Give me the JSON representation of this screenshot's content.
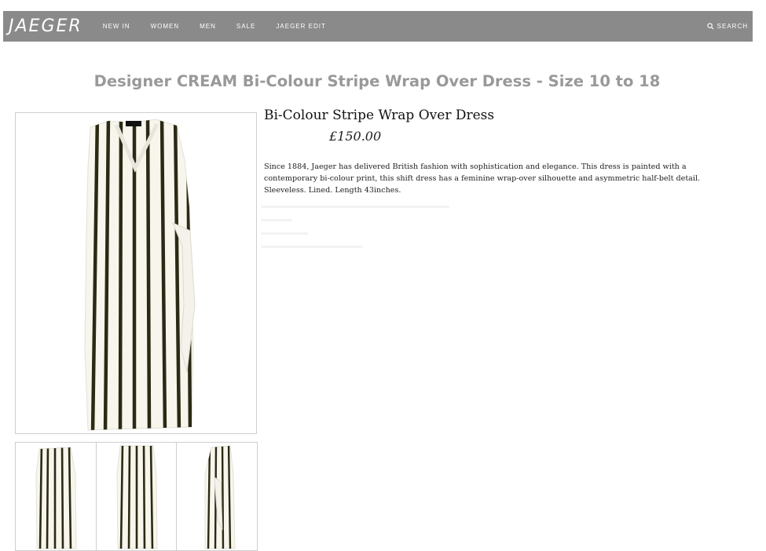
{
  "nav": {
    "logo": "JAEGER",
    "items": [
      {
        "label": "NEW IN"
      },
      {
        "label": "WOMEN"
      },
      {
        "label": "MEN"
      },
      {
        "label": "SALE"
      },
      {
        "label": "JAEGER EDIT"
      }
    ],
    "search_label": "SEARCH",
    "background": "#8a8a8a"
  },
  "page": {
    "title": "Designer CREAM Bi-Colour Stripe Wrap Over Dress - Size 10 to 18"
  },
  "product": {
    "name": "Bi-Colour Stripe Wrap Over Dress",
    "price": "£150.00",
    "description": "Since 1884, Jaeger has delivered British fashion with sophistication and elegance. This dress is painted with a contemporary bi-colour print, this shift dress has a feminine wrap-over silhouette and asymmetric half-belt detail. Sleeveless. Lined. Length 43inches.",
    "colors": {
      "fabric": "#f7f5ec",
      "stripe": "#2a2a14"
    }
  }
}
